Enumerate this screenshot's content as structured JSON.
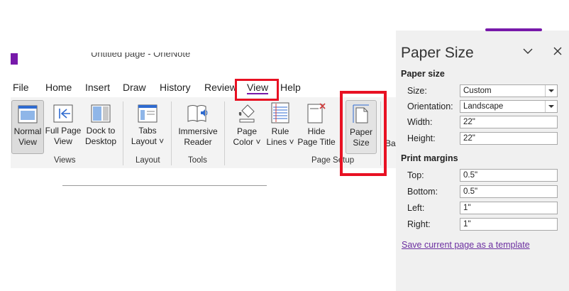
{
  "app": {
    "window_title": "Untitled page - OneNote"
  },
  "menu": {
    "items": [
      "File",
      "Home",
      "Insert",
      "Draw",
      "History",
      "Review",
      "View",
      "Help"
    ],
    "active": "View"
  },
  "ribbon": {
    "partial_label": "Ba",
    "buttons": {
      "normal_view": [
        "Normal",
        "View"
      ],
      "full_page_view": [
        "Full Page",
        "View"
      ],
      "dock_to_desktop": [
        "Dock to",
        "Desktop"
      ],
      "tabs_layout": [
        "Tabs",
        "Layout ˅"
      ],
      "immersive_reader": [
        "Immersive",
        "Reader"
      ],
      "page_color": [
        "Page",
        "Color ˅"
      ],
      "rule_lines": [
        "Rule",
        "Lines ˅"
      ],
      "hide_page_title": [
        "Hide",
        "Page Title"
      ],
      "paper_size": [
        "Paper",
        "Size"
      ]
    },
    "groups": {
      "views": "Views",
      "layout": "Layout",
      "tools": "Tools",
      "page_setup": "Page Setup"
    }
  },
  "pane": {
    "title": "Paper Size",
    "paper_size_section": "Paper size",
    "size_label": "Size:",
    "size_value": "Custom",
    "orientation_label": "Orientation:",
    "orientation_value": "Landscape",
    "width_label": "Width:",
    "width_value": "22\"",
    "height_label": "Height:",
    "height_value": "22\"",
    "margins_section": "Print margins",
    "top_label": "Top:",
    "top_value": "0.5\"",
    "bottom_label": "Bottom:",
    "bottom_value": "0.5\"",
    "left_label": "Left:",
    "left_value": "1\"",
    "right_label": "Right:",
    "right_value": "1\"",
    "template_link": "Save current page as a template"
  },
  "colors": {
    "accent": "#7719aa",
    "highlight": "#e81123"
  }
}
